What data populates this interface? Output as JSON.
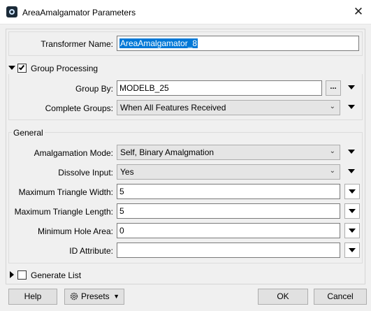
{
  "window": {
    "title": "AreaAmalgamator Parameters"
  },
  "transformer_name": {
    "label": "Transformer Name:",
    "value": "AreaAmalgamator_8"
  },
  "group_processing": {
    "label": "Group Processing",
    "checked": true,
    "group_by": {
      "label": "Group By:",
      "value": "MODELB_25",
      "browse_label": "..."
    },
    "complete_groups": {
      "label": "Complete Groups:",
      "value": "When All Features Received"
    }
  },
  "general": {
    "label": "General",
    "amalgamation_mode": {
      "label": "Amalgamation Mode:",
      "value": "Self, Binary Amalgmation"
    },
    "dissolve_input": {
      "label": "Dissolve Input:",
      "value": "Yes"
    },
    "max_triangle_width": {
      "label": "Maximum Triangle Width:",
      "value": "5"
    },
    "max_triangle_length": {
      "label": "Maximum Triangle Length:",
      "value": "5"
    },
    "min_hole_area": {
      "label": "Minimum Hole Area:",
      "value": "0"
    },
    "id_attribute": {
      "label": "ID Attribute:",
      "value": ""
    }
  },
  "generate_list": {
    "label": "Generate List",
    "checked": false
  },
  "footer": {
    "help_label": "Help",
    "presets_label": "Presets",
    "ok_label": "OK",
    "cancel_label": "Cancel"
  }
}
